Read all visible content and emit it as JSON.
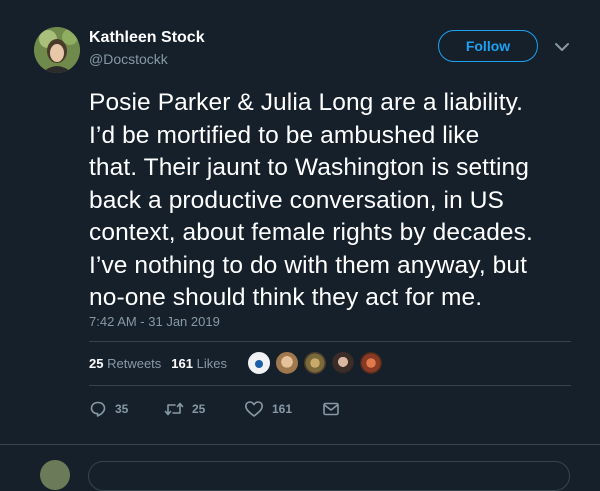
{
  "author": {
    "name": "Kathleen Stock",
    "handle": "@Docstockk"
  },
  "follow_label": "Follow",
  "tweet": {
    "lines": [
      "Posie Parker & Julia Long are a liability.",
      "I’d be mortified to be ambushed like",
      "that. Their jaunt to Washington is setting",
      "back a productive conversation, in US",
      "context, about female rights by decades.",
      "I’ve nothing to do with them anyway, but",
      "no-one should think they act for me."
    ],
    "timestamp": "7:42 AM - 31 Jan 2019"
  },
  "stats": {
    "retweets_count": "25",
    "retweets_label": "Retweets",
    "likes_count": "161",
    "likes_label": "Likes"
  },
  "actions": {
    "reply_count": "35",
    "retweet_count": "25",
    "like_count": "161"
  },
  "colors": {
    "background": "#15202b",
    "accent": "#1da1f2",
    "secondary_text": "#8899a6",
    "divider": "#38444d"
  },
  "icons": [
    "caret-down-icon",
    "reply-icon",
    "retweet-icon",
    "heart-icon",
    "message-icon"
  ]
}
